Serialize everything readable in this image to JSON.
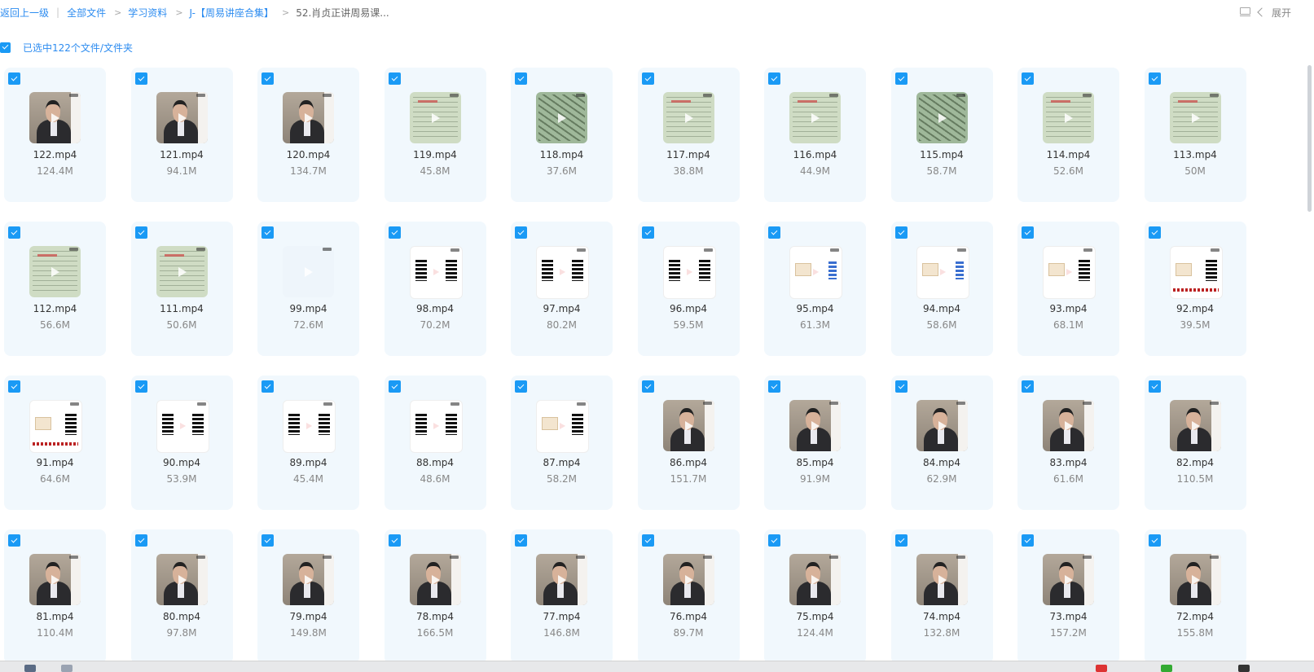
{
  "breadcrumb": {
    "back": "返回上一级",
    "all_files": "全部文件",
    "level1": "学习资料",
    "level2": "J-【周易讲座合集】",
    "current": "52.肖贞正讲周易课..."
  },
  "toolbar": {
    "expand_label": "展开",
    "view_icon": "layout-icon",
    "chevron_icon": "chevron-left-icon"
  },
  "selection": {
    "label": "已选中122个文件/文件夹"
  },
  "colors": {
    "accent": "#2d8cf0",
    "check": "#1a9af5",
    "card_bg": "#f1f8fd"
  },
  "files": [
    {
      "name": "122.mp4",
      "size": "124.4M",
      "thumb": "person"
    },
    {
      "name": "121.mp4",
      "size": "94.1M",
      "thumb": "person"
    },
    {
      "name": "120.mp4",
      "size": "134.7M",
      "thumb": "person"
    },
    {
      "name": "119.mp4",
      "size": "45.8M",
      "thumb": "map"
    },
    {
      "name": "118.mp4",
      "size": "37.6M",
      "thumb": "dark"
    },
    {
      "name": "117.mp4",
      "size": "38.8M",
      "thumb": "map"
    },
    {
      "name": "116.mp4",
      "size": "44.9M",
      "thumb": "map"
    },
    {
      "name": "115.mp4",
      "size": "58.7M",
      "thumb": "dark"
    },
    {
      "name": "114.mp4",
      "size": "52.6M",
      "thumb": "map"
    },
    {
      "name": "113.mp4",
      "size": "50M",
      "thumb": "map"
    },
    {
      "name": "112.mp4",
      "size": "56.6M",
      "thumb": "map"
    },
    {
      "name": "111.mp4",
      "size": "50.6M",
      "thumb": "map"
    },
    {
      "name": "99.mp4",
      "size": "72.6M",
      "thumb": "blank"
    },
    {
      "name": "98.mp4",
      "size": "70.2M",
      "thumb": "hexa"
    },
    {
      "name": "97.mp4",
      "size": "80.2M",
      "thumb": "hexa"
    },
    {
      "name": "96.mp4",
      "size": "59.5M",
      "thumb": "hexa"
    },
    {
      "name": "95.mp4",
      "size": "61.3M",
      "thumb": "hexa-blue"
    },
    {
      "name": "94.mp4",
      "size": "58.6M",
      "thumb": "hexa-blue"
    },
    {
      "name": "93.mp4",
      "size": "68.1M",
      "thumb": "hexa-tan"
    },
    {
      "name": "92.mp4",
      "size": "39.5M",
      "thumb": "hexa-red"
    },
    {
      "name": "91.mp4",
      "size": "64.6M",
      "thumb": "hexa-red"
    },
    {
      "name": "90.mp4",
      "size": "53.9M",
      "thumb": "hexa"
    },
    {
      "name": "89.mp4",
      "size": "45.4M",
      "thumb": "hexa"
    },
    {
      "name": "88.mp4",
      "size": "48.6M",
      "thumb": "hexa"
    },
    {
      "name": "87.mp4",
      "size": "58.2M",
      "thumb": "hexa-tan"
    },
    {
      "name": "86.mp4",
      "size": "151.7M",
      "thumb": "person"
    },
    {
      "name": "85.mp4",
      "size": "91.9M",
      "thumb": "person"
    },
    {
      "name": "84.mp4",
      "size": "62.9M",
      "thumb": "person"
    },
    {
      "name": "83.mp4",
      "size": "61.6M",
      "thumb": "person"
    },
    {
      "name": "82.mp4",
      "size": "110.5M",
      "thumb": "person"
    },
    {
      "name": "81.mp4",
      "size": "110.4M",
      "thumb": "person"
    },
    {
      "name": "80.mp4",
      "size": "97.8M",
      "thumb": "person"
    },
    {
      "name": "79.mp4",
      "size": "149.8M",
      "thumb": "person"
    },
    {
      "name": "78.mp4",
      "size": "166.5M",
      "thumb": "person"
    },
    {
      "name": "77.mp4",
      "size": "146.8M",
      "thumb": "person"
    },
    {
      "name": "76.mp4",
      "size": "89.7M",
      "thumb": "person"
    },
    {
      "name": "75.mp4",
      "size": "124.4M",
      "thumb": "person"
    },
    {
      "name": "74.mp4",
      "size": "132.8M",
      "thumb": "person"
    },
    {
      "name": "73.mp4",
      "size": "157.2M",
      "thumb": "person"
    },
    {
      "name": "72.mp4",
      "size": "155.8M",
      "thumb": "person"
    }
  ]
}
